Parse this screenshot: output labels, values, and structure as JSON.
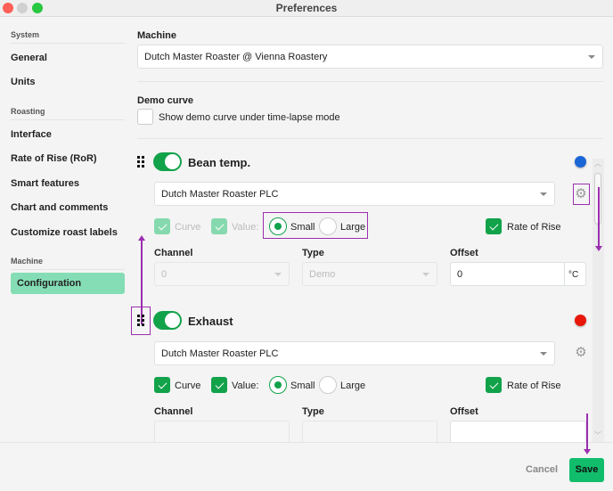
{
  "window": {
    "title": "Preferences"
  },
  "sidebar": {
    "sections": [
      {
        "label": "System",
        "items": [
          {
            "label": "General"
          },
          {
            "label": "Units"
          }
        ]
      },
      {
        "label": "Roasting",
        "items": [
          {
            "label": "Interface"
          },
          {
            "label": "Rate of Rise (RoR)"
          },
          {
            "label": "Smart features"
          },
          {
            "label": "Chart and comments"
          },
          {
            "label": "Customize roast labels"
          }
        ]
      },
      {
        "label": "Machine",
        "items": [
          {
            "label": "Configuration",
            "active": true
          }
        ]
      }
    ]
  },
  "main": {
    "machine": {
      "label": "Machine",
      "value": "Dutch Master Roaster @ Vienna Roastery"
    },
    "demo_curve": {
      "label": "Demo curve",
      "checkbox_label": "Show demo curve under time-lapse mode",
      "checked": false
    },
    "channels": [
      {
        "name": "Bean temp.",
        "enabled": true,
        "color": "#1a66d6",
        "source": "Dutch Master Roaster PLC",
        "curve": {
          "label": "Curve",
          "checked": true,
          "disabled": true
        },
        "value": {
          "label": "Value:",
          "checked": true,
          "disabled": true
        },
        "size": {
          "options": [
            "Small",
            "Large"
          ],
          "selected": "Small"
        },
        "ror": {
          "label": "Rate of Rise",
          "checked": true
        },
        "channel": {
          "label": "Channel",
          "value": "0"
        },
        "type": {
          "label": "Type",
          "value": "Demo"
        },
        "offset": {
          "label": "Offset",
          "value": "0",
          "unit": "°C"
        }
      },
      {
        "name": "Exhaust",
        "enabled": true,
        "color": "#e8170a",
        "source": "Dutch Master Roaster PLC",
        "curve": {
          "label": "Curve",
          "checked": true,
          "disabled": false
        },
        "value": {
          "label": "Value:",
          "checked": true,
          "disabled": false
        },
        "size": {
          "options": [
            "Small",
            "Large"
          ],
          "selected": "Small"
        },
        "ror": {
          "label": "Rate of Rise",
          "checked": true
        },
        "channel": {
          "label": "Channel"
        },
        "type": {
          "label": "Type"
        },
        "offset": {
          "label": "Offset"
        }
      }
    ]
  },
  "footer": {
    "cancel_label": "Cancel",
    "save_label": "Save"
  },
  "colors": {
    "accent": "#11a24a",
    "save": "#11bd6b",
    "annotation": "#9b2fae",
    "active_nav": "#84ddb4"
  }
}
